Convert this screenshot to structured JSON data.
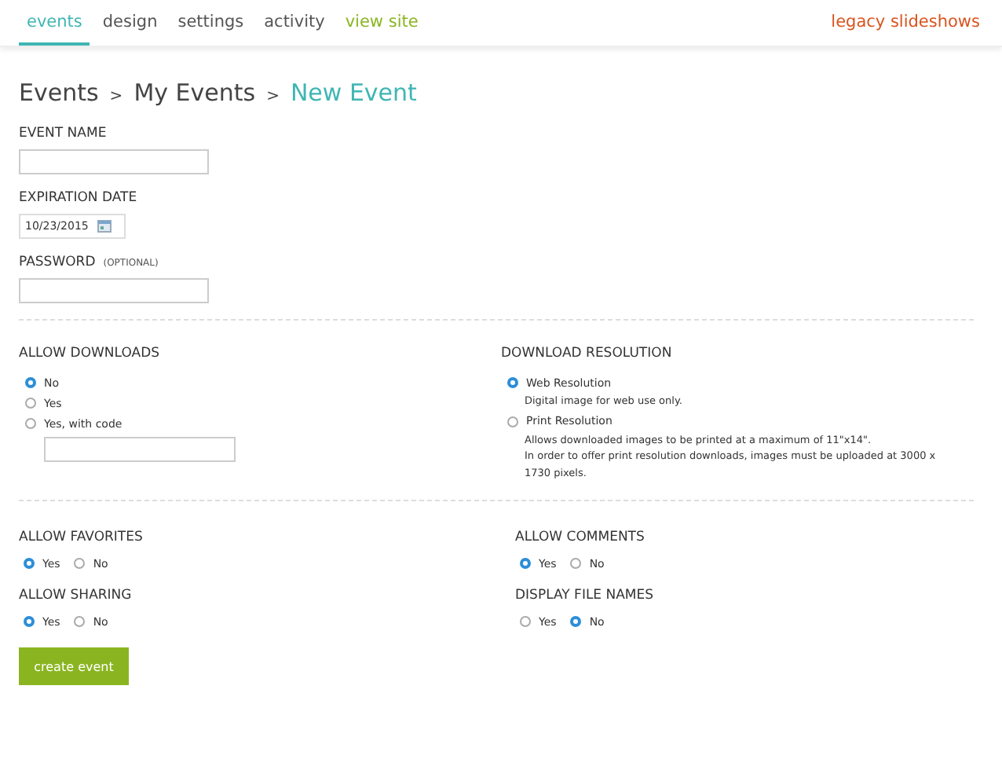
{
  "nav": {
    "tabs": [
      {
        "label": "events",
        "selected": true,
        "kind": "tab"
      },
      {
        "label": "design",
        "selected": false,
        "kind": "tab"
      },
      {
        "label": "settings",
        "selected": false,
        "kind": "tab"
      },
      {
        "label": "activity",
        "selected": false,
        "kind": "tab"
      },
      {
        "label": "view site",
        "selected": false,
        "kind": "site"
      }
    ],
    "right_link": "legacy slideshows"
  },
  "breadcrumb": [
    {
      "label": "Events",
      "current": false
    },
    {
      "label": "My Events",
      "current": false
    },
    {
      "label": "New Event",
      "current": true
    }
  ],
  "breadcrumb_separator": ">",
  "fields": [
    {
      "label": "EVENT NAME",
      "kind": "text"
    },
    {
      "label": "EXPIRATION DATE",
      "kind": "date",
      "value": "10/23/2015"
    },
    {
      "label": "PASSWORD",
      "hint": "(OPTIONAL)",
      "kind": "text"
    }
  ],
  "downloads": {
    "label": "ALLOW DOWNLOADS",
    "options": [
      {
        "label": "No",
        "selected": true
      },
      {
        "label": "Yes",
        "selected": false
      },
      {
        "label": "Yes, with code",
        "selected": false
      }
    ]
  },
  "resolution": {
    "label": "DOWNLOAD RESOLUTION",
    "options": [
      {
        "label": "Web Resolution",
        "selected": true,
        "description": [
          "Digital image for web use only."
        ]
      },
      {
        "label": "Print Resolution",
        "selected": false,
        "description": [
          "Allows downloaded images to be printed at a maximum of 11\"x14\".",
          "In order to offer print resolution downloads, images must be uploaded at 3000 x 1730 pixels."
        ]
      }
    ]
  },
  "toggles": [
    {
      "label": "ALLOW FAVORITES",
      "options": [
        {
          "label": "Yes",
          "selected": true
        },
        {
          "label": "No",
          "selected": false
        }
      ]
    },
    {
      "label": "ALLOW COMMENTS",
      "options": [
        {
          "label": "Yes",
          "selected": true
        },
        {
          "label": "No",
          "selected": false
        }
      ]
    },
    {
      "label": "ALLOW SHARING",
      "options": [
        {
          "label": "Yes",
          "selected": true
        },
        {
          "label": "No",
          "selected": false
        }
      ]
    },
    {
      "label": "DISPLAY FILE NAMES",
      "options": [
        {
          "label": "Yes",
          "selected": false
        },
        {
          "label": "No",
          "selected": true
        }
      ]
    }
  ],
  "submit": "create event"
}
